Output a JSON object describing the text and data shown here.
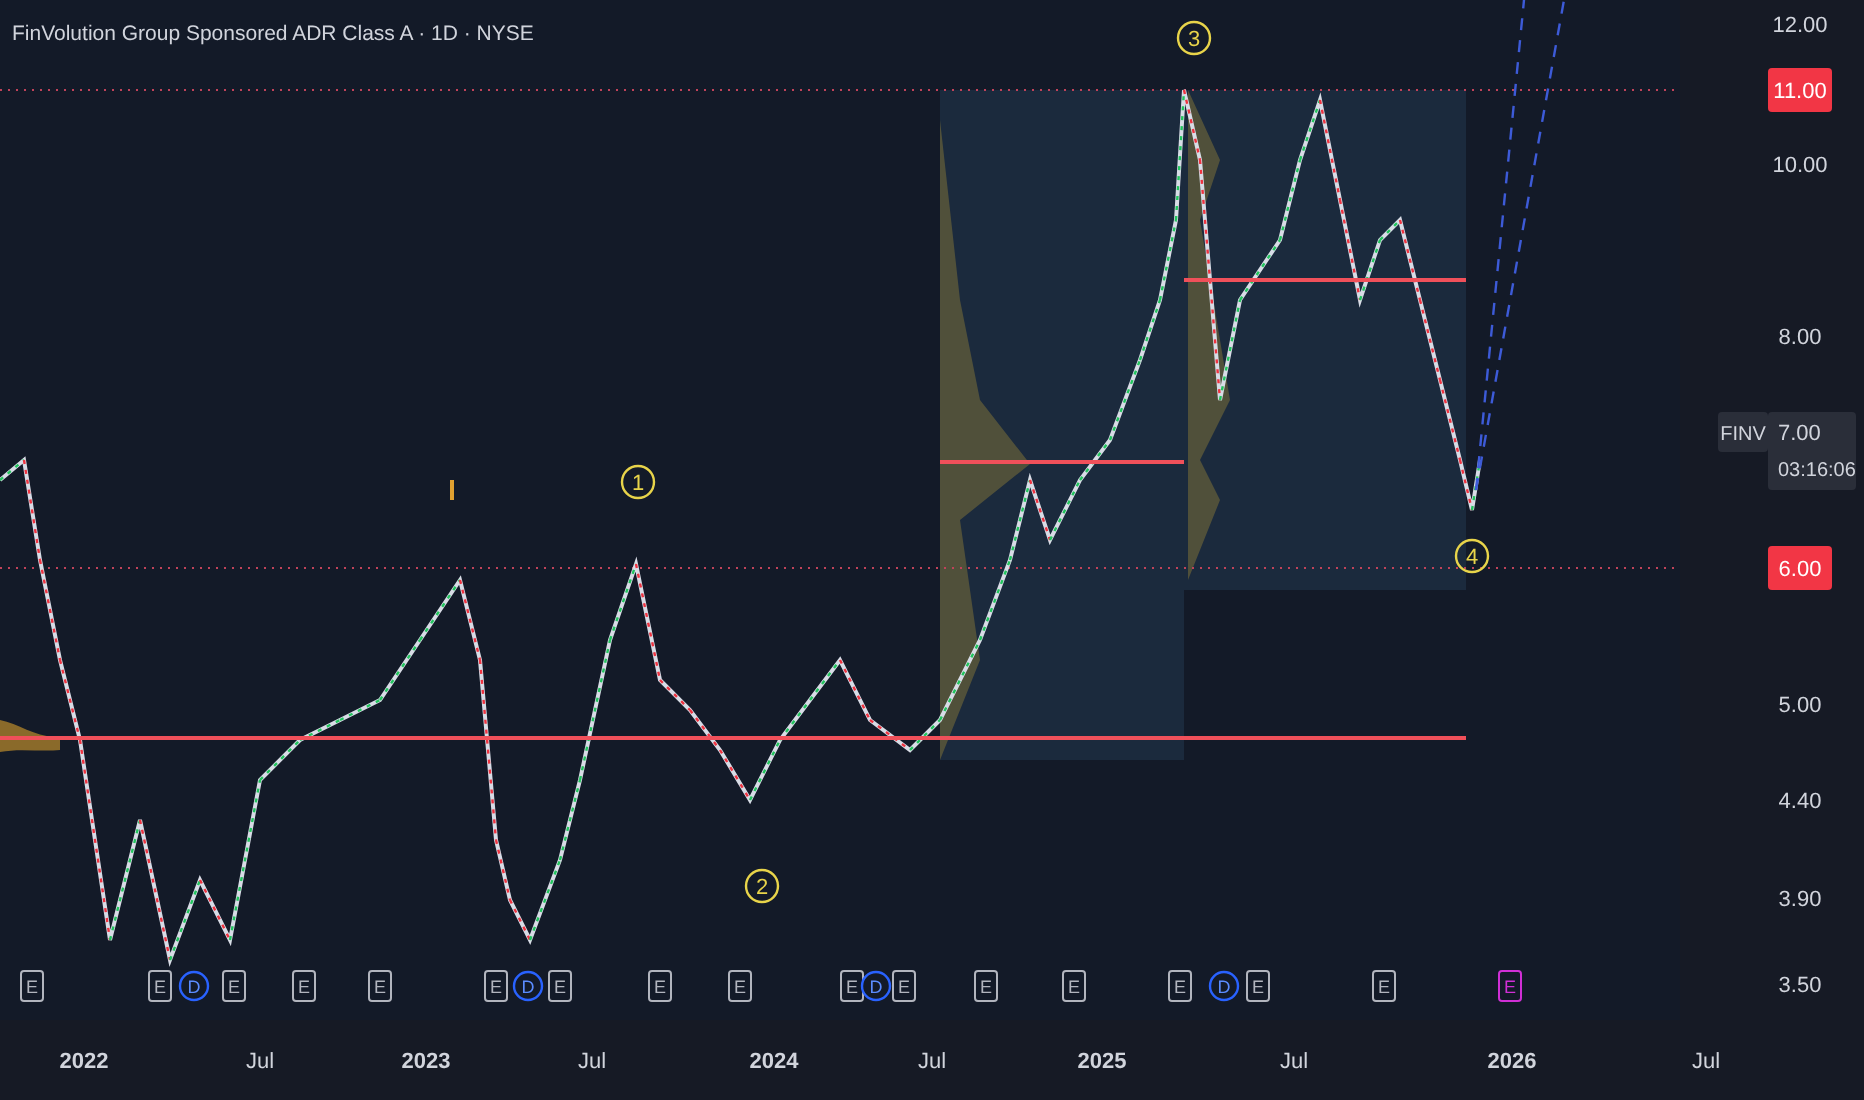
{
  "title": "FinVolution Group Sponsored ADR Class A · 1D · NYSE",
  "y_axis": {
    "ticks": [
      "12.00",
      "10.00",
      "8.00",
      "5.00",
      "4.40",
      "3.90",
      "3.50"
    ]
  },
  "price_alerts": [
    {
      "value": "11.00"
    },
    {
      "value": "6.00"
    }
  ],
  "last_price": {
    "symbol": "FINV",
    "price": "7.00",
    "countdown": "03:16:06"
  },
  "x_axis": {
    "ticks": [
      "2022",
      "Jul",
      "2023",
      "Jul",
      "2024",
      "Jul",
      "2025",
      "Jul",
      "2026",
      "Jul"
    ]
  },
  "wave_labels": [
    "1",
    "2",
    "3",
    "4"
  ],
  "events": [
    {
      "label": "E",
      "kind": "earnings"
    },
    {
      "label": "E",
      "kind": "earnings"
    },
    {
      "label": "D",
      "kind": "dividend"
    },
    {
      "label": "E",
      "kind": "earnings"
    },
    {
      "label": "E",
      "kind": "earnings"
    },
    {
      "label": "E",
      "kind": "earnings"
    },
    {
      "label": "E",
      "kind": "earnings"
    },
    {
      "label": "D",
      "kind": "dividend"
    },
    {
      "label": "E",
      "kind": "earnings"
    },
    {
      "label": "E",
      "kind": "earnings"
    },
    {
      "label": "E",
      "kind": "earnings"
    },
    {
      "label": "E",
      "kind": "earnings"
    },
    {
      "label": "D",
      "kind": "dividend"
    },
    {
      "label": "E",
      "kind": "earnings"
    },
    {
      "label": "E",
      "kind": "earnings"
    },
    {
      "label": "E",
      "kind": "earnings"
    },
    {
      "label": "E",
      "kind": "earnings"
    },
    {
      "label": "D",
      "kind": "dividend"
    },
    {
      "label": "E",
      "kind": "earnings"
    },
    {
      "label": "E",
      "kind": "earnings"
    },
    {
      "label": "E",
      "kind": "upcoming"
    }
  ]
}
